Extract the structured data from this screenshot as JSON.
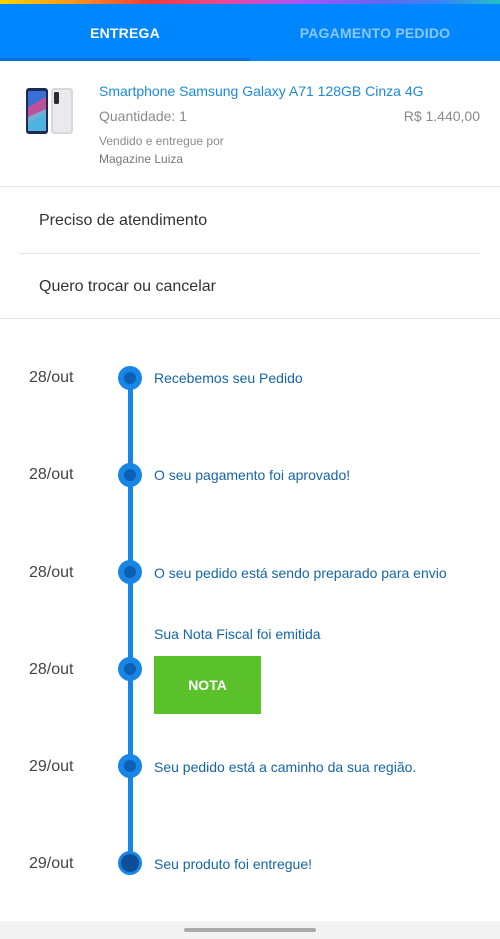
{
  "tabs": [
    {
      "label": "ENTREGA",
      "active": true
    },
    {
      "label": "PAGAMENTO PEDIDO",
      "active": false
    }
  ],
  "product": {
    "name": "Smartphone Samsung Galaxy A71 128GB Cinza 4G",
    "quantity": "Quantidade: 1",
    "price": "R$ 1.440,00",
    "sold_by": "Vendido e entregue por",
    "seller": "Magazine Luiza"
  },
  "menu": [
    {
      "label": "Preciso de atendimento"
    },
    {
      "label": "Quero trocar ou cancelar"
    }
  ],
  "timeline": [
    {
      "date": "28/out",
      "text": "Recebemos seu Pedido"
    },
    {
      "date": "28/out",
      "text": "O seu pagamento foi aprovado!"
    },
    {
      "date": "28/out",
      "text": "O seu pedido está sendo preparado para envio"
    },
    {
      "date": "28/out",
      "text": "Sua Nota Fiscal foi emitida",
      "button": "NOTA"
    },
    {
      "date": "29/out",
      "text": "Seu pedido está a caminho da sua região."
    },
    {
      "date": "29/out",
      "text": "Seu produto foi entregue!"
    }
  ],
  "colors": {
    "brand_blue": "#0086ff",
    "timeline_blue": "#1786e6",
    "nota_green": "#5ac12a"
  }
}
